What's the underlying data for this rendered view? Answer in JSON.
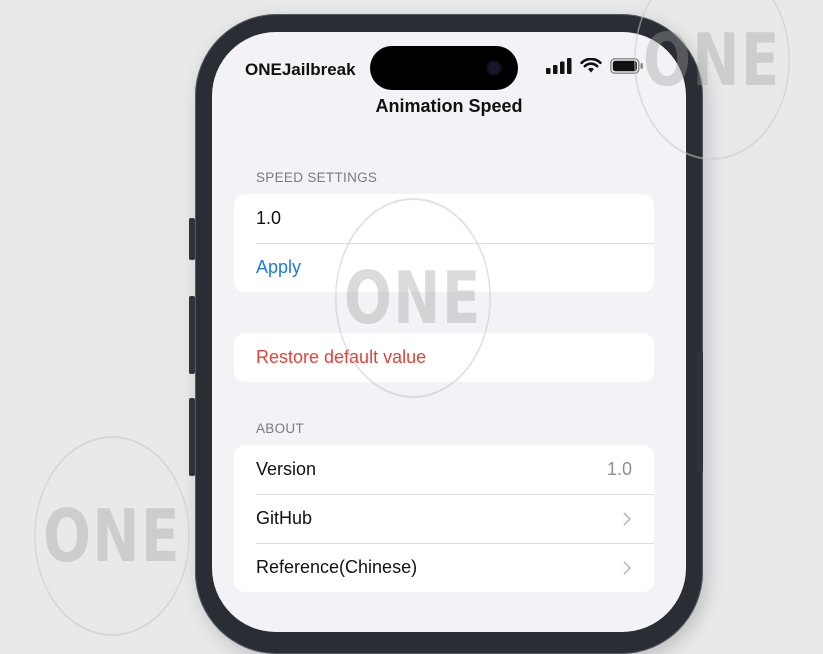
{
  "watermark": {
    "text": "ONE"
  },
  "status_bar": {
    "carrier": "ONEJailbreak",
    "icons": [
      "cellular-signal-icon",
      "wifi-icon",
      "battery-icon"
    ]
  },
  "nav": {
    "title": "Animation Speed"
  },
  "speed_settings": {
    "header": "SPEED SETTINGS",
    "field_value": "1.0",
    "apply_label": "Apply"
  },
  "restore": {
    "label": "Restore default value"
  },
  "about": {
    "header": "ABOUT",
    "version_label": "Version",
    "version_value": "1.0",
    "github_label": "GitHub",
    "reference_label": "Reference(Chinese)"
  },
  "colors": {
    "link": "#1d7be0",
    "destructive": "#e0433a",
    "background": "#f2f2f7"
  }
}
